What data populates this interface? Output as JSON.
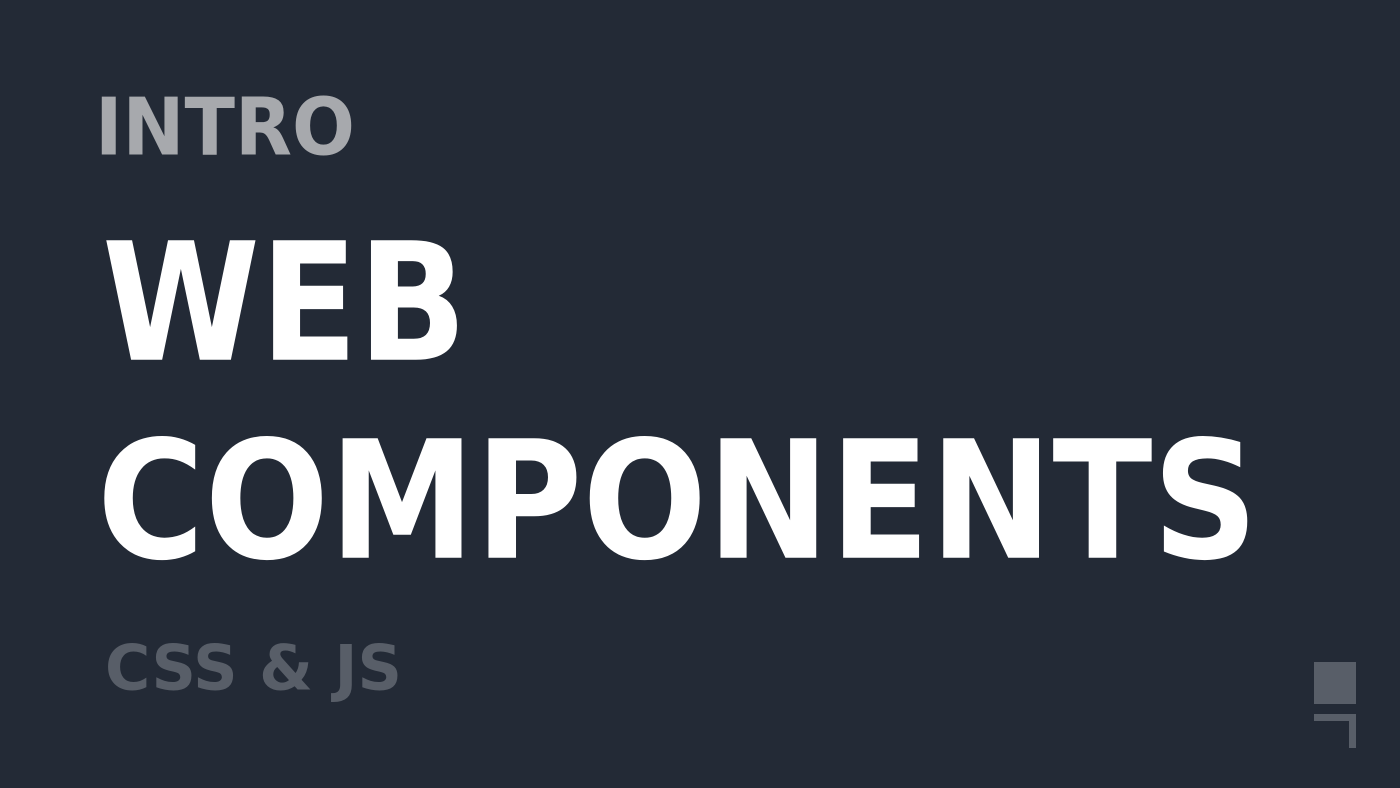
{
  "title": {
    "kicker": "INTRO",
    "line1": "WEB",
    "line2": "COMPONENTS",
    "subtitle": "CSS & JS"
  },
  "colors": {
    "background": "#232a36",
    "kicker": "#a7a9ad",
    "headline": "#ffffff",
    "subtitle": "#585e68",
    "logo": "#585e68"
  },
  "logo": {
    "icon": "bracket-logo-icon"
  }
}
